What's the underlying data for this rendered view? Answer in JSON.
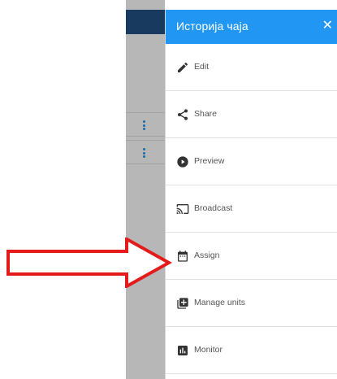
{
  "drawer": {
    "title": "Историја чаја",
    "close_icon": "close-icon",
    "items": [
      {
        "label": "Edit",
        "icon": "pencil-icon"
      },
      {
        "label": "Share",
        "icon": "share-icon"
      },
      {
        "label": "Preview",
        "icon": "play-circle-icon"
      },
      {
        "label": "Broadcast",
        "icon": "cast-icon"
      },
      {
        "label": "Assign",
        "icon": "calendar-icon"
      },
      {
        "label": "Manage units",
        "icon": "add-to-library-icon"
      },
      {
        "label": "Monitor",
        "icon": "bar-chart-icon"
      }
    ]
  },
  "colors": {
    "header": "#2196f3",
    "background_panel": "#b7b7b7",
    "background_topbar": "#173a5e",
    "kebab_dots": "#1c6aa6",
    "annotation_arrow": "#e31b1b"
  }
}
